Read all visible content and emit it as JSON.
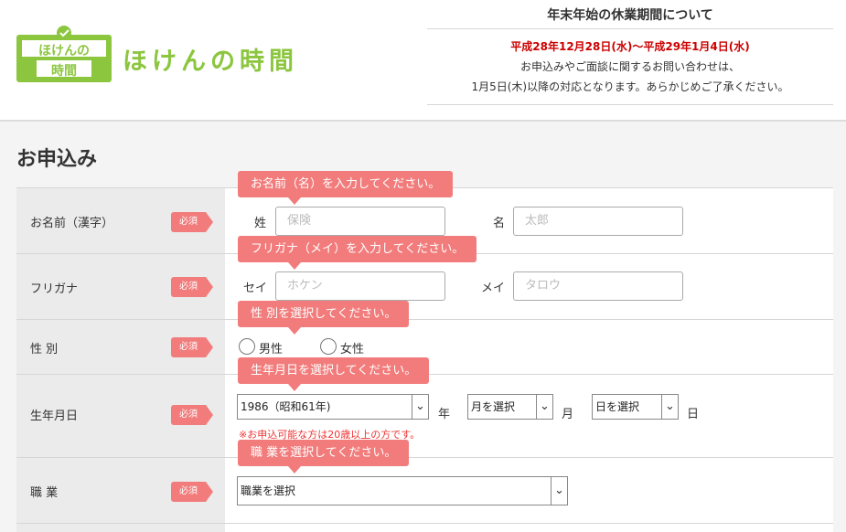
{
  "header": {
    "logo_text": "ほけんの時間",
    "logo_mark_top": "ほけんの",
    "logo_mark_bottom": "時間",
    "notice": {
      "title": "年末年始の休業期間について",
      "period": "平成28年12月28日(水)～平成29年1月4日(水)",
      "line1": "お申込みやご面談に関するお問い合わせは、",
      "line2": "1月5日(木)以降の対応となります。あらかじめご了承ください。"
    },
    "brand_color": "#8cc63f"
  },
  "section_title": "お申込み",
  "required_label": "必須",
  "accent_color": "#f27c7c",
  "form": {
    "name": {
      "label": "お名前（漢字）",
      "tooltip": "お名前（名）を入力してください。",
      "sei_label": "姓",
      "sei_placeholder": "保険",
      "mei_label": "名",
      "mei_placeholder": "太郎"
    },
    "kana": {
      "label": "フリガナ",
      "tooltip": "フリガナ（メイ）を入力してください。",
      "sei_label": "セイ",
      "sei_placeholder": "ホケン",
      "mei_label": "メイ",
      "mei_placeholder": "タロウ"
    },
    "gender": {
      "label": "性 別",
      "tooltip": "性 別を選択してください。",
      "male": "男性",
      "female": "女性"
    },
    "birthday": {
      "label": "生年月日",
      "tooltip": "生年月日を選択してください。",
      "year_value": "1986（昭和61年)",
      "year_unit": "年",
      "month_value": "月を選択",
      "month_unit": "月",
      "day_value": "日を選択",
      "day_unit": "日",
      "note": "※お申込可能な方は20歳以上の方です。"
    },
    "job": {
      "label": "職 業",
      "tooltip": "職 業を選択してください。",
      "value": "職業を選択"
    }
  }
}
